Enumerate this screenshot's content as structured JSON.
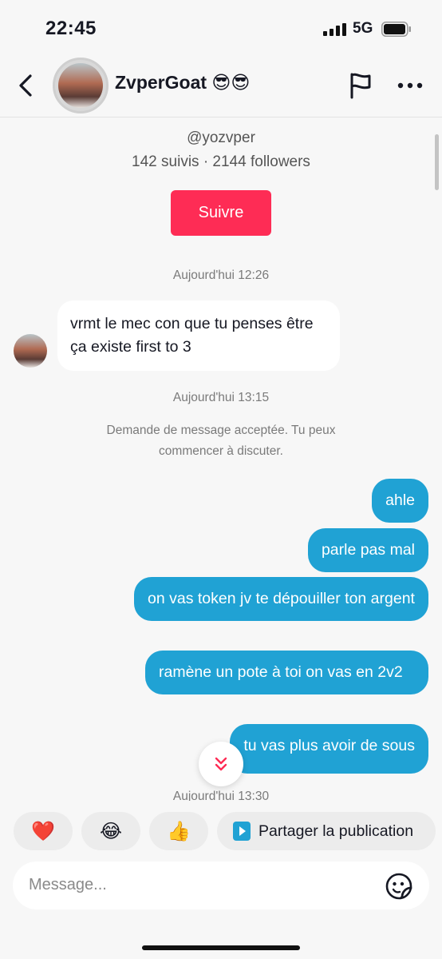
{
  "status_bar": {
    "time": "22:45",
    "network": "5G",
    "icons": [
      "signal-bars-icon",
      "battery-icon"
    ]
  },
  "header": {
    "title": "ZvperGoat 😎😎",
    "icons": [
      "back-arrow-icon",
      "flag-icon",
      "more-dots-icon"
    ]
  },
  "profile": {
    "handle": "@yozvper",
    "stats": "142 suivis · 2144 followers",
    "follow_label": "Suivre"
  },
  "messages": {
    "timestamp_1": "Aujourd'hui 12:26",
    "incoming_1": "vrmt le mec con que tu penses être ça existe first to 3",
    "timestamp_2": "Aujourd'hui 13:15",
    "system_line_1": "Demande de message acceptée. Tu peux",
    "system_line_2": "commencer à discuter.",
    "outgoing": [
      "ahle",
      "parle pas mal",
      "on vas token jv te dépouiller ton argent",
      "ramène un pote à toi on vas en 2v2",
      "tu vas plus avoir de sous"
    ],
    "timestamp_3": "Aujourd'hui 13:30"
  },
  "quick_replies": {
    "heart": "❤️",
    "laugh": "😂",
    "thumbs_up": "👍",
    "share_label": "Partager la publication"
  },
  "composer": {
    "placeholder": "Message..."
  },
  "colors": {
    "accent_red": "#fe2c55",
    "bubble_blue": "#20a2d4",
    "background": "#f7f7f7"
  }
}
